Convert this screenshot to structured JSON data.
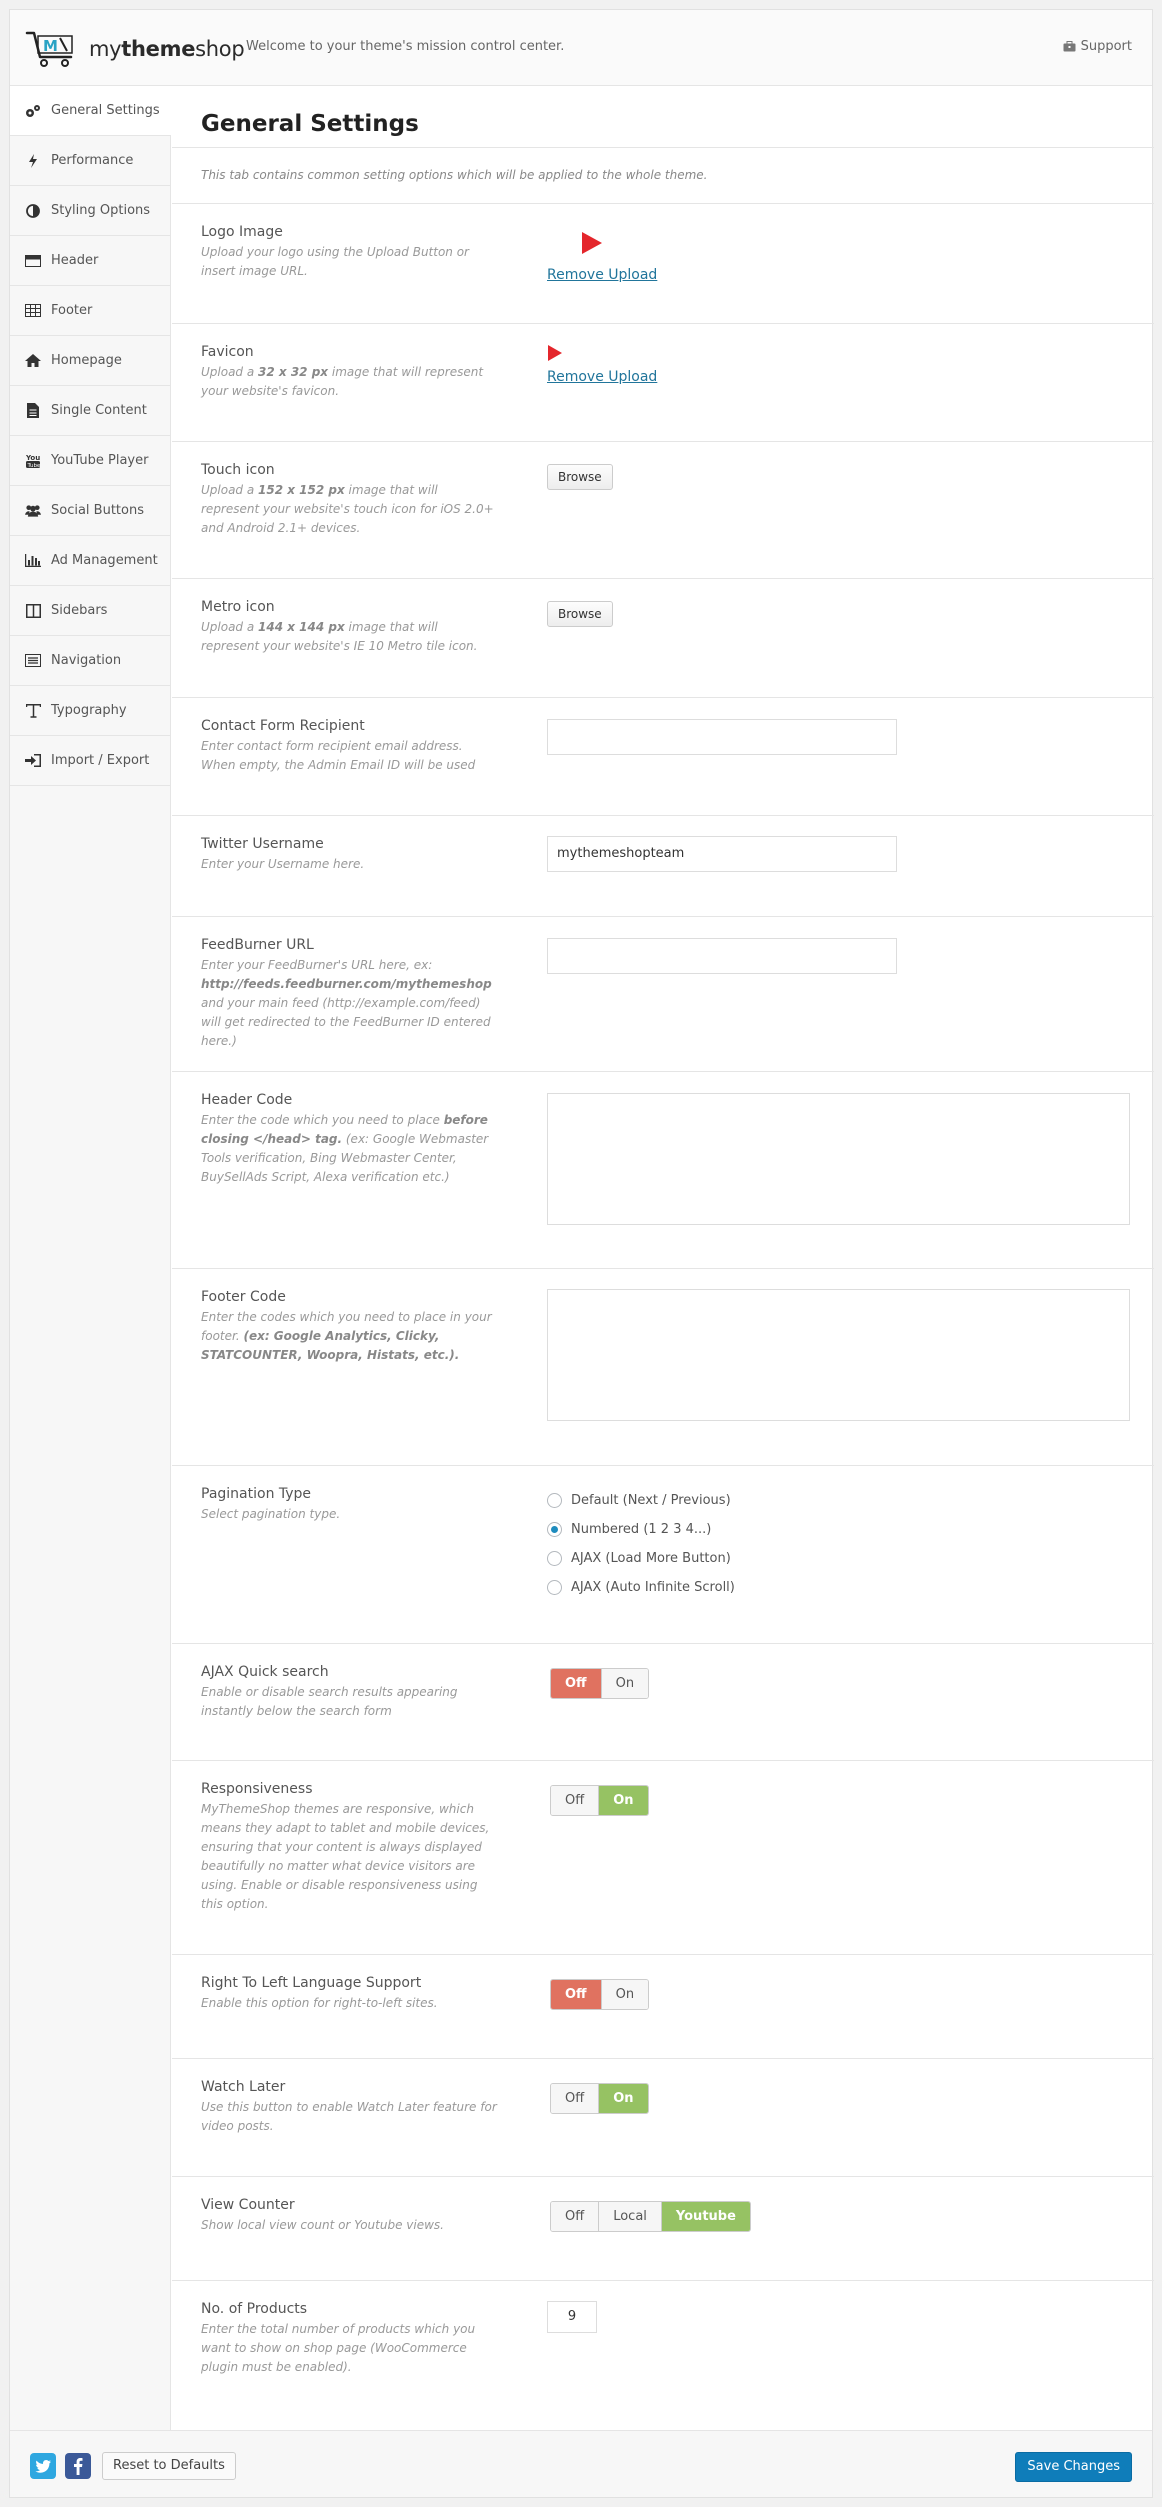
{
  "header": {
    "brand_light": "my",
    "brand_bold": "theme",
    "brand_tail": "shop",
    "tagline": "Welcome to your theme's mission control center.",
    "support_label": "Support"
  },
  "sidebar": {
    "items": [
      {
        "label": "General Settings",
        "icon": "gears-icon",
        "active": true
      },
      {
        "label": "Performance",
        "icon": "bolt-icon"
      },
      {
        "label": "Styling Options",
        "icon": "contrast-icon"
      },
      {
        "label": "Header",
        "icon": "header-icon"
      },
      {
        "label": "Footer",
        "icon": "table-icon"
      },
      {
        "label": "Homepage",
        "icon": "home-icon"
      },
      {
        "label": "Single Content",
        "icon": "document-icon"
      },
      {
        "label": "YouTube Player",
        "icon": "youtube-icon"
      },
      {
        "label": "Social Buttons",
        "icon": "users-icon"
      },
      {
        "label": "Ad Management",
        "icon": "bar-chart-icon"
      },
      {
        "label": "Sidebars",
        "icon": "columns-icon"
      },
      {
        "label": "Navigation",
        "icon": "navigation-icon"
      },
      {
        "label": "Typography",
        "icon": "typography-icon"
      },
      {
        "label": "Import / Export",
        "icon": "sign-in-icon"
      }
    ]
  },
  "main": {
    "title": "General Settings",
    "description": "This tab contains common setting options which will be applied to the whole theme.",
    "logo": {
      "title": "Logo Image",
      "desc": "Upload your logo using the Upload Button or insert image URL.",
      "remove_label": "Remove Upload"
    },
    "favicon": {
      "title": "Favicon",
      "desc_pre": "Upload a ",
      "desc_bold": "32 x 32 px",
      "desc_post": " image that will represent your website's favicon.",
      "remove_label": "Remove Upload"
    },
    "touch": {
      "title": "Touch icon",
      "desc_pre": "Upload a ",
      "desc_bold": "152 x 152 px",
      "desc_post": " image that will represent your website's touch icon for iOS 2.0+ and Android 2.1+ devices.",
      "browse_label": "Browse"
    },
    "metro": {
      "title": "Metro icon",
      "desc_pre": "Upload a ",
      "desc_bold": "144 x 144 px",
      "desc_post": " image that will represent your website's IE 10 Metro tile icon.",
      "browse_label": "Browse"
    },
    "contact": {
      "title": "Contact Form Recipient",
      "desc": "Enter contact form recipient email address. When empty, the Admin Email ID will be used",
      "value": ""
    },
    "twitter": {
      "title": "Twitter Username",
      "desc": "Enter your Username here.",
      "value": "mythemeshopteam"
    },
    "feedburner": {
      "title": "FeedBurner URL",
      "desc_pre": "Enter your FeedBurner's URL here, ex: ",
      "desc_bold": "http://feeds.feedburner.com/mythemeshop",
      "desc_post": " and your main feed (http://example.com/feed) will get redirected to the FeedBurner ID entered here.)",
      "value": ""
    },
    "header_code": {
      "title": "Header Code",
      "desc_pre": "Enter the code which you need to place ",
      "desc_bold": "before closing </head> tag.",
      "desc_post": " (ex: Google Webmaster Tools verification, Bing Webmaster Center, BuySellAds Script, Alexa verification etc.)"
    },
    "footer_code": {
      "title": "Footer Code",
      "desc_pre": "Enter the codes which you need to place in your footer. ",
      "desc_bold": "(ex: Google Analytics, Clicky, STATCOUNTER, Woopra, Histats, etc.)."
    },
    "pagination": {
      "title": "Pagination Type",
      "desc": "Select pagination type.",
      "options": [
        "Default (Next / Previous)",
        "Numbered (1 2 3 4...)",
        "AJAX (Load More Button)",
        "AJAX (Auto Infinite Scroll)"
      ],
      "selected": "Numbered (1 2 3 4...)"
    },
    "ajax_search": {
      "title": "AJAX Quick search",
      "desc": "Enable or disable search results appearing instantly below the search form",
      "off": "Off",
      "on": "On",
      "state": "Off"
    },
    "responsive": {
      "title": "Responsiveness",
      "desc": "MyThemeShop themes are responsive, which means they adapt to tablet and mobile devices, ensuring that your content is always displayed beautifully no matter what device visitors are using. Enable or disable responsiveness using this option.",
      "off": "Off",
      "on": "On",
      "state": "On"
    },
    "rtl": {
      "title": "Right To Left Language Support",
      "desc": "Enable this option for right-to-left sites.",
      "off": "Off",
      "on": "On",
      "state": "Off"
    },
    "watch_later": {
      "title": "Watch Later",
      "desc": "Use this button to enable Watch Later feature for video posts.",
      "off": "Off",
      "on": "On",
      "state": "On"
    },
    "view_counter": {
      "title": "View Counter",
      "desc": "Show local view count or Youtube views.",
      "off": "Off",
      "local": "Local",
      "youtube": "Youtube",
      "state": "Youtube"
    },
    "products": {
      "title": "No. of Products",
      "desc": "Enter the total number of products which you want to show on shop page (WooCommerce plugin must be enabled).",
      "value": "9"
    }
  },
  "footer": {
    "reset_label": "Reset to Defaults",
    "save_label": "Save Changes"
  },
  "colors": {
    "accent_blue": "#0f7dba",
    "off_red": "#e07260",
    "on_green": "#96c263",
    "play_red": "#e4262c"
  }
}
